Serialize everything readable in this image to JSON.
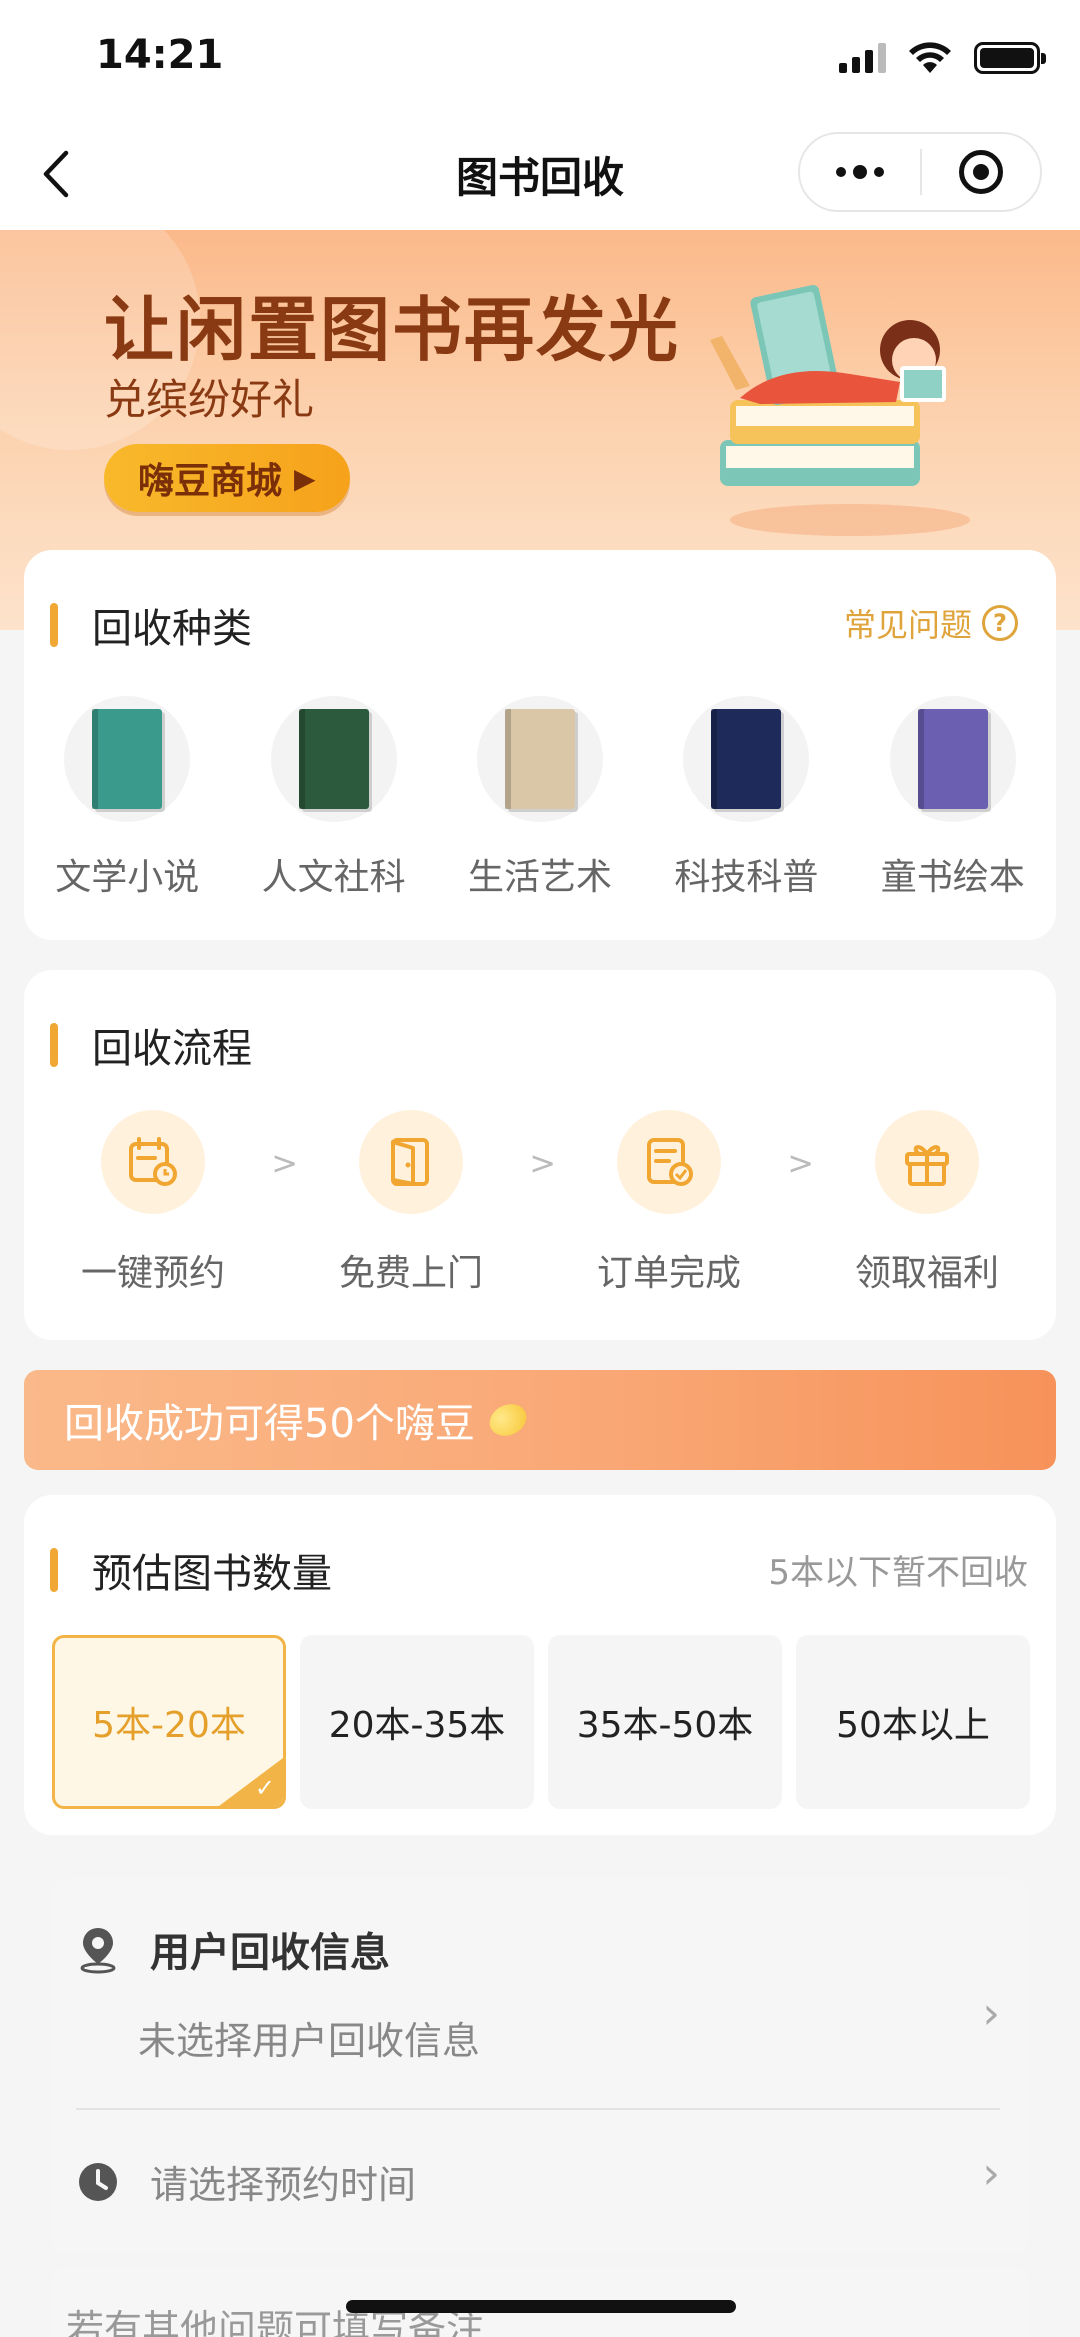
{
  "status_bar": {
    "time": "14:21"
  },
  "nav": {
    "title": "图书回收"
  },
  "banner": {
    "title": "让闲置图书再发光",
    "subtitle": "兑缤纷好礼",
    "button_label": "嗨豆商城"
  },
  "types_section": {
    "title": "回收种类",
    "faq_label": "常见问题",
    "items": [
      {
        "label": "文学小说",
        "book_color": "#3a9a8b"
      },
      {
        "label": "人文社科",
        "book_color": "#2c5a3c"
      },
      {
        "label": "生活艺术",
        "book_color": "#d9c7a8"
      },
      {
        "label": "科技科普",
        "book_color": "#1e2a5a"
      },
      {
        "label": "童书绘本",
        "book_color": "#6a5fb0"
      }
    ]
  },
  "flow_section": {
    "title": "回收流程",
    "steps": [
      {
        "label": "一键预约",
        "icon": "calendar-icon"
      },
      {
        "label": "免费上门",
        "icon": "door-icon"
      },
      {
        "label": "订单完成",
        "icon": "document-check-icon"
      },
      {
        "label": "领取福利",
        "icon": "gift-icon"
      }
    ]
  },
  "reward": {
    "text": "回收成功可得50个嗨豆"
  },
  "quantity_section": {
    "title": "预估图书数量",
    "note": "5本以下暂不回收",
    "options": [
      {
        "label": "5本-20本",
        "selected": true
      },
      {
        "label": "20本-35本",
        "selected": false
      },
      {
        "label": "35本-50本",
        "selected": false
      },
      {
        "label": "50本以上",
        "selected": false
      }
    ]
  },
  "user_info": {
    "title": "用户回收信息",
    "placeholder": "未选择用户回收信息",
    "time_placeholder": "请选择预约时间"
  },
  "remark": {
    "placeholder": "若有其他问题可填写备注"
  },
  "colors": {
    "accent": "#f1a733",
    "banner_text": "#8a3a12"
  }
}
